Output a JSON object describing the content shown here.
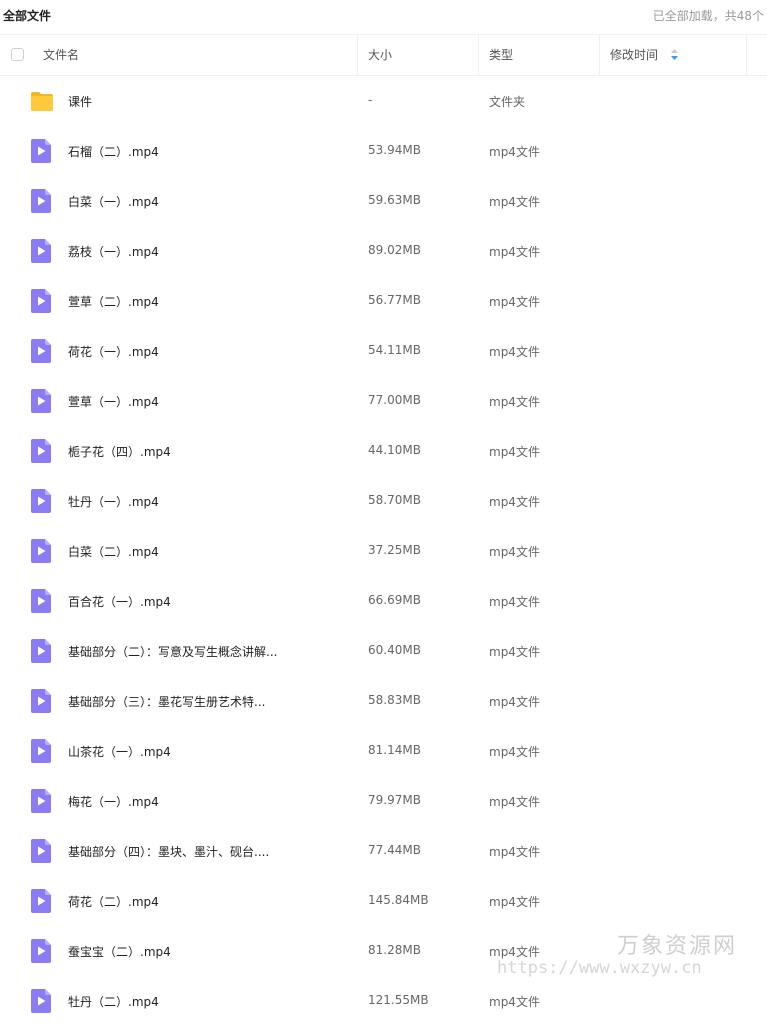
{
  "topbar": {
    "breadcrumb": "全部文件",
    "load_status": "已全部加载，共48个"
  },
  "table_header": {
    "name": "文件名",
    "size": "大小",
    "type": "类型",
    "modified": "修改时间"
  },
  "colors": {
    "folder": "#ffc93b",
    "video_file": "#8b7cf6",
    "sort_active": "#2a9dff"
  },
  "rows": [
    {
      "name": "课件",
      "size": "-",
      "type": "文件夹",
      "icon": "folder-icon"
    },
    {
      "name": "石榴（二）.mp4",
      "size": "53.94MB",
      "type": "mp4文件",
      "icon": "video-file-icon"
    },
    {
      "name": "白菜（一）.mp4",
      "size": "59.63MB",
      "type": "mp4文件",
      "icon": "video-file-icon"
    },
    {
      "name": "荔枝（一）.mp4",
      "size": "89.02MB",
      "type": "mp4文件",
      "icon": "video-file-icon"
    },
    {
      "name": "萱草（二）.mp4",
      "size": "56.77MB",
      "type": "mp4文件",
      "icon": "video-file-icon"
    },
    {
      "name": "荷花（一）.mp4",
      "size": "54.11MB",
      "type": "mp4文件",
      "icon": "video-file-icon"
    },
    {
      "name": "萱草（一）.mp4",
      "size": "77.00MB",
      "type": "mp4文件",
      "icon": "video-file-icon"
    },
    {
      "name": "栀子花（四）.mp4",
      "size": "44.10MB",
      "type": "mp4文件",
      "icon": "video-file-icon"
    },
    {
      "name": "牡丹（一）.mp4",
      "size": "58.70MB",
      "type": "mp4文件",
      "icon": "video-file-icon"
    },
    {
      "name": "白菜（二）.mp4",
      "size": "37.25MB",
      "type": "mp4文件",
      "icon": "video-file-icon"
    },
    {
      "name": "百合花（一）.mp4",
      "size": "66.69MB",
      "type": "mp4文件",
      "icon": "video-file-icon"
    },
    {
      "name": "基础部分（二）：写意及写生概念讲解...",
      "size": "60.40MB",
      "type": "mp4文件",
      "icon": "video-file-icon"
    },
    {
      "name": "基础部分（三）：墨花写生册艺术特...",
      "size": "58.83MB",
      "type": "mp4文件",
      "icon": "video-file-icon"
    },
    {
      "name": "山茶花（一）.mp4",
      "size": "81.14MB",
      "type": "mp4文件",
      "icon": "video-file-icon"
    },
    {
      "name": "梅花（一）.mp4",
      "size": "79.97MB",
      "type": "mp4文件",
      "icon": "video-file-icon"
    },
    {
      "name": "基础部分（四）：墨块、墨汁、砚台....",
      "size": "77.44MB",
      "type": "mp4文件",
      "icon": "video-file-icon"
    },
    {
      "name": "荷花（二）.mp4",
      "size": "145.84MB",
      "type": "mp4文件",
      "icon": "video-file-icon"
    },
    {
      "name": "蚕宝宝（二）.mp4",
      "size": "81.28MB",
      "type": "mp4文件",
      "icon": "video-file-icon"
    },
    {
      "name": "牡丹（二）.mp4",
      "size": "121.55MB",
      "type": "mp4文件",
      "icon": "video-file-icon"
    }
  ],
  "watermark": {
    "title": "万象资源网",
    "url": "https://www.wxzyw.cn"
  }
}
